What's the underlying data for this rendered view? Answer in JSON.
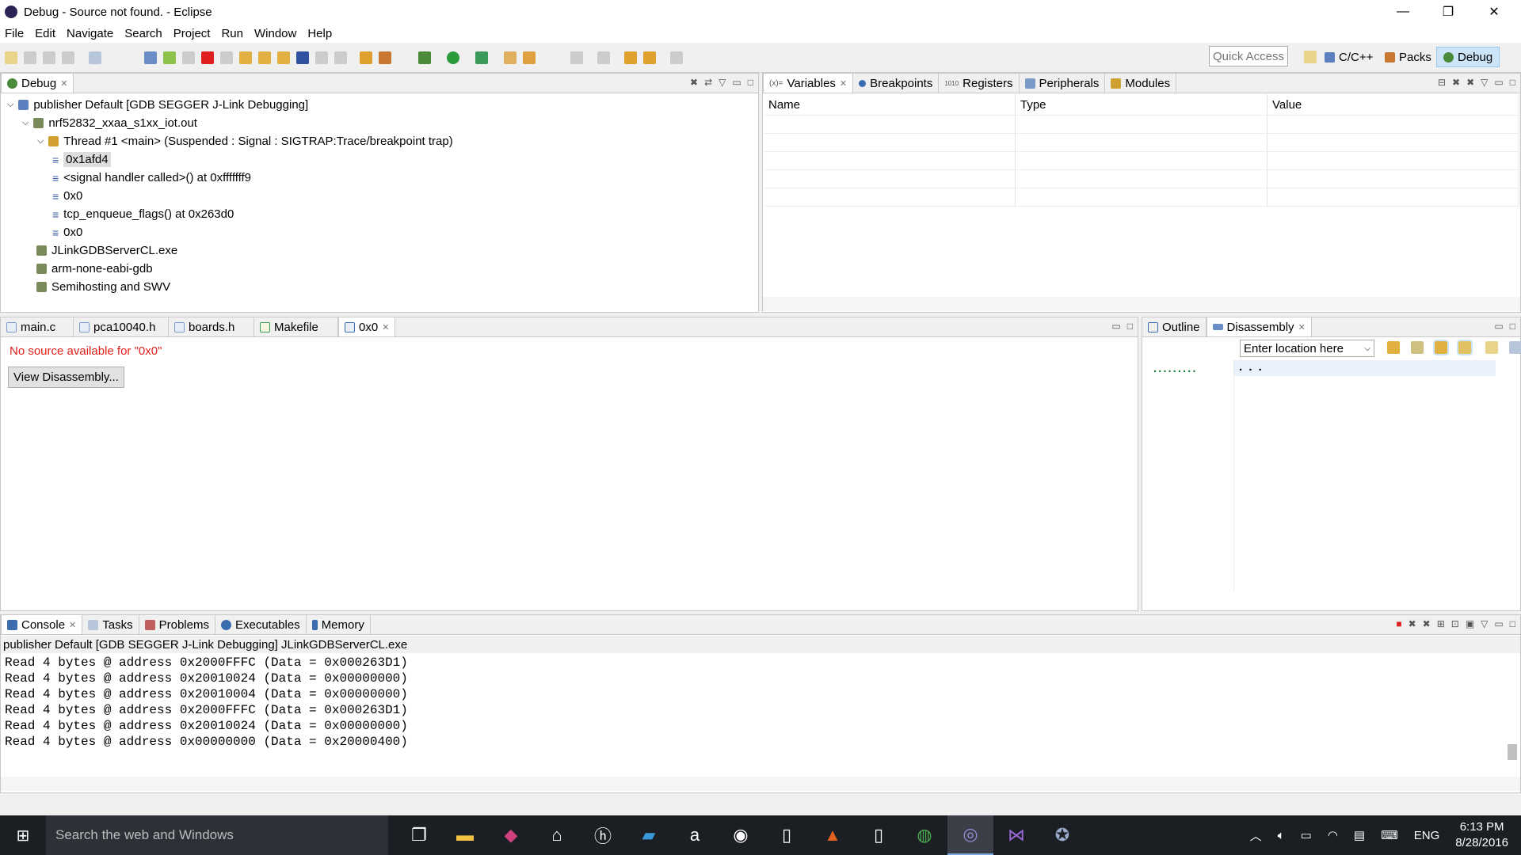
{
  "window": {
    "title": "Debug - Source not found. - Eclipse",
    "minimize": "—",
    "restore": "❐",
    "close": "✕"
  },
  "menu": [
    "File",
    "Edit",
    "Navigate",
    "Search",
    "Project",
    "Run",
    "Window",
    "Help"
  ],
  "quick_access": {
    "placeholder": "Quick Access"
  },
  "perspectives": [
    {
      "label": "C/C++"
    },
    {
      "label": "Packs"
    },
    {
      "label": "Debug",
      "active": true
    }
  ],
  "debug_view": {
    "tab": "Debug",
    "tree": [
      {
        "label": "publisher Default [GDB SEGGER J-Link Debugging]",
        "level": 0,
        "icon": "launch-icon"
      },
      {
        "label": "nrf52832_xxaa_s1xx_iot.out",
        "level": 1,
        "icon": "process-icon"
      },
      {
        "label": "Thread #1 <main> (Suspended : Signal : SIGTRAP:Trace/breakpoint trap)",
        "level": 2,
        "icon": "thread-icon"
      },
      {
        "label": "0x1afd4",
        "level": 3,
        "icon": "stack-frame-icon",
        "selected": true
      },
      {
        "label": "<signal handler called>() at 0xfffffff9",
        "level": 3,
        "icon": "stack-frame-icon"
      },
      {
        "label": "0x0",
        "level": 3,
        "icon": "stack-frame-icon"
      },
      {
        "label": "tcp_enqueue_flags() at 0x263d0",
        "level": 3,
        "icon": "stack-frame-icon"
      },
      {
        "label": "0x0",
        "level": 3,
        "icon": "stack-frame-icon"
      },
      {
        "label": "JLinkGDBServerCL.exe",
        "level": 1,
        "icon": "process-icon"
      },
      {
        "label": "arm-none-eabi-gdb",
        "level": 1,
        "icon": "process-icon"
      },
      {
        "label": "Semihosting and SWV",
        "level": 1,
        "icon": "process-icon"
      }
    ]
  },
  "variables_view": {
    "tabs": [
      "Variables",
      "Breakpoints",
      "Registers",
      "Peripherals",
      "Modules"
    ],
    "columns": [
      "Name",
      "Type",
      "Value"
    ]
  },
  "editor": {
    "tabs": [
      "main.c",
      "pca10040.h",
      "boards.h",
      "Makefile",
      "0x0"
    ],
    "message": "No source available for \"0x0\"",
    "button": "View Disassembly..."
  },
  "disassembly": {
    "tabs": [
      "Outline",
      "Disassembly"
    ],
    "location_placeholder": "Enter location here",
    "gutter": ".........",
    "content": ". . ."
  },
  "console": {
    "tabs": [
      "Console",
      "Tasks",
      "Problems",
      "Executables",
      "Memory"
    ],
    "process": "publisher Default [GDB SEGGER J-Link Debugging] JLinkGDBServerCL.exe",
    "lines": [
      "Read 4 bytes @ address 0x2000FFFC (Data = 0x000263D1)",
      "Read 4 bytes @ address 0x20010024 (Data = 0x00000000)",
      "Read 4 bytes @ address 0x20010004 (Data = 0x00000000)",
      "Read 4 bytes @ address 0x2000FFFC (Data = 0x000263D1)",
      "Read 4 bytes @ address 0x20010024 (Data = 0x00000000)",
      "Read 4 bytes @ address 0x00000000 (Data = 0x20000400)"
    ]
  },
  "taskbar": {
    "search_placeholder": "Search the web and Windows",
    "language": "ENG",
    "time": "6:13 PM",
    "date": "8/28/2016"
  },
  "colors": {
    "error_text": "#e0201b",
    "active_perspective": "#cce4f7",
    "taskbar": "#1b1f24"
  }
}
